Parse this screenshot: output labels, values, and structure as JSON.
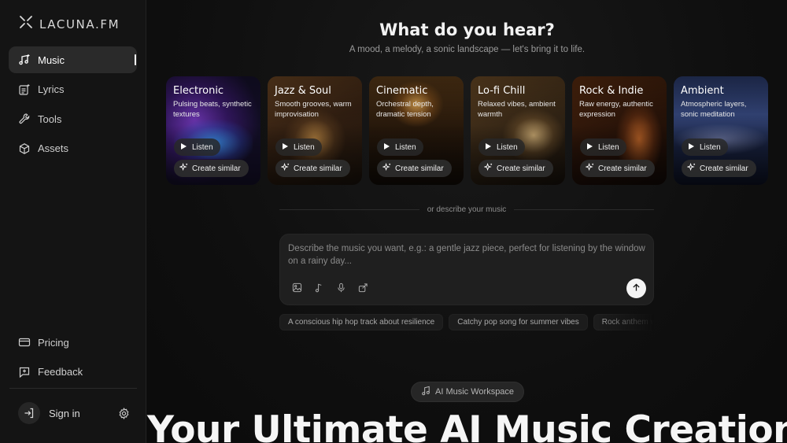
{
  "brand": {
    "name": "LACUNA.FM",
    "icon": "x-logo-icon"
  },
  "sidebar": {
    "items": [
      {
        "label": "Music",
        "icon": "music-note-icon",
        "active": true
      },
      {
        "label": "Lyrics",
        "icon": "lyrics-doc-icon",
        "active": false
      },
      {
        "label": "Tools",
        "icon": "wrench-icon",
        "active": false
      },
      {
        "label": "Assets",
        "icon": "cube-icon",
        "active": false
      }
    ],
    "bottom_items": [
      {
        "label": "Pricing",
        "icon": "card-icon"
      },
      {
        "label": "Feedback",
        "icon": "feedback-icon"
      }
    ],
    "sign_in": "Sign in"
  },
  "main": {
    "headline": "What do you hear?",
    "subline": "A mood, a melody, a sonic landscape — let's bring it to life.",
    "cards": [
      {
        "title": "Electronic",
        "desc": "Pulsing beats, synthetic textures",
        "listen": "Listen",
        "similar": "Create similar"
      },
      {
        "title": "Jazz & Soul",
        "desc": "Smooth grooves, warm improvisation",
        "listen": "Listen",
        "similar": "Create similar"
      },
      {
        "title": "Cinematic",
        "desc": "Orchestral depth, dramatic tension",
        "listen": "Listen",
        "similar": "Create similar"
      },
      {
        "title": "Lo-fi Chill",
        "desc": "Relaxed vibes, ambient warmth",
        "listen": "Listen",
        "similar": "Create similar"
      },
      {
        "title": "Rock & Indie",
        "desc": "Raw energy, authentic expression",
        "listen": "Listen",
        "similar": "Create similar"
      },
      {
        "title": "Ambient",
        "desc": "Atmospheric layers, sonic meditation",
        "listen": "Listen",
        "similar": "Create similar"
      }
    ],
    "or_text": "or describe your music",
    "prompt": {
      "placeholder": "Describe the music you want, e.g.: a gentle jazz piece, perfect for listening by the window on a rainy day...",
      "value": ""
    },
    "chips": [
      "A conscious hip hop track about resilience",
      "Catchy pop song for summer vibes",
      "Rock anthem with powerful guitar riffs"
    ],
    "badge": "AI Music Workspace",
    "hero": "Your Ultimate AI Music Creation"
  }
}
